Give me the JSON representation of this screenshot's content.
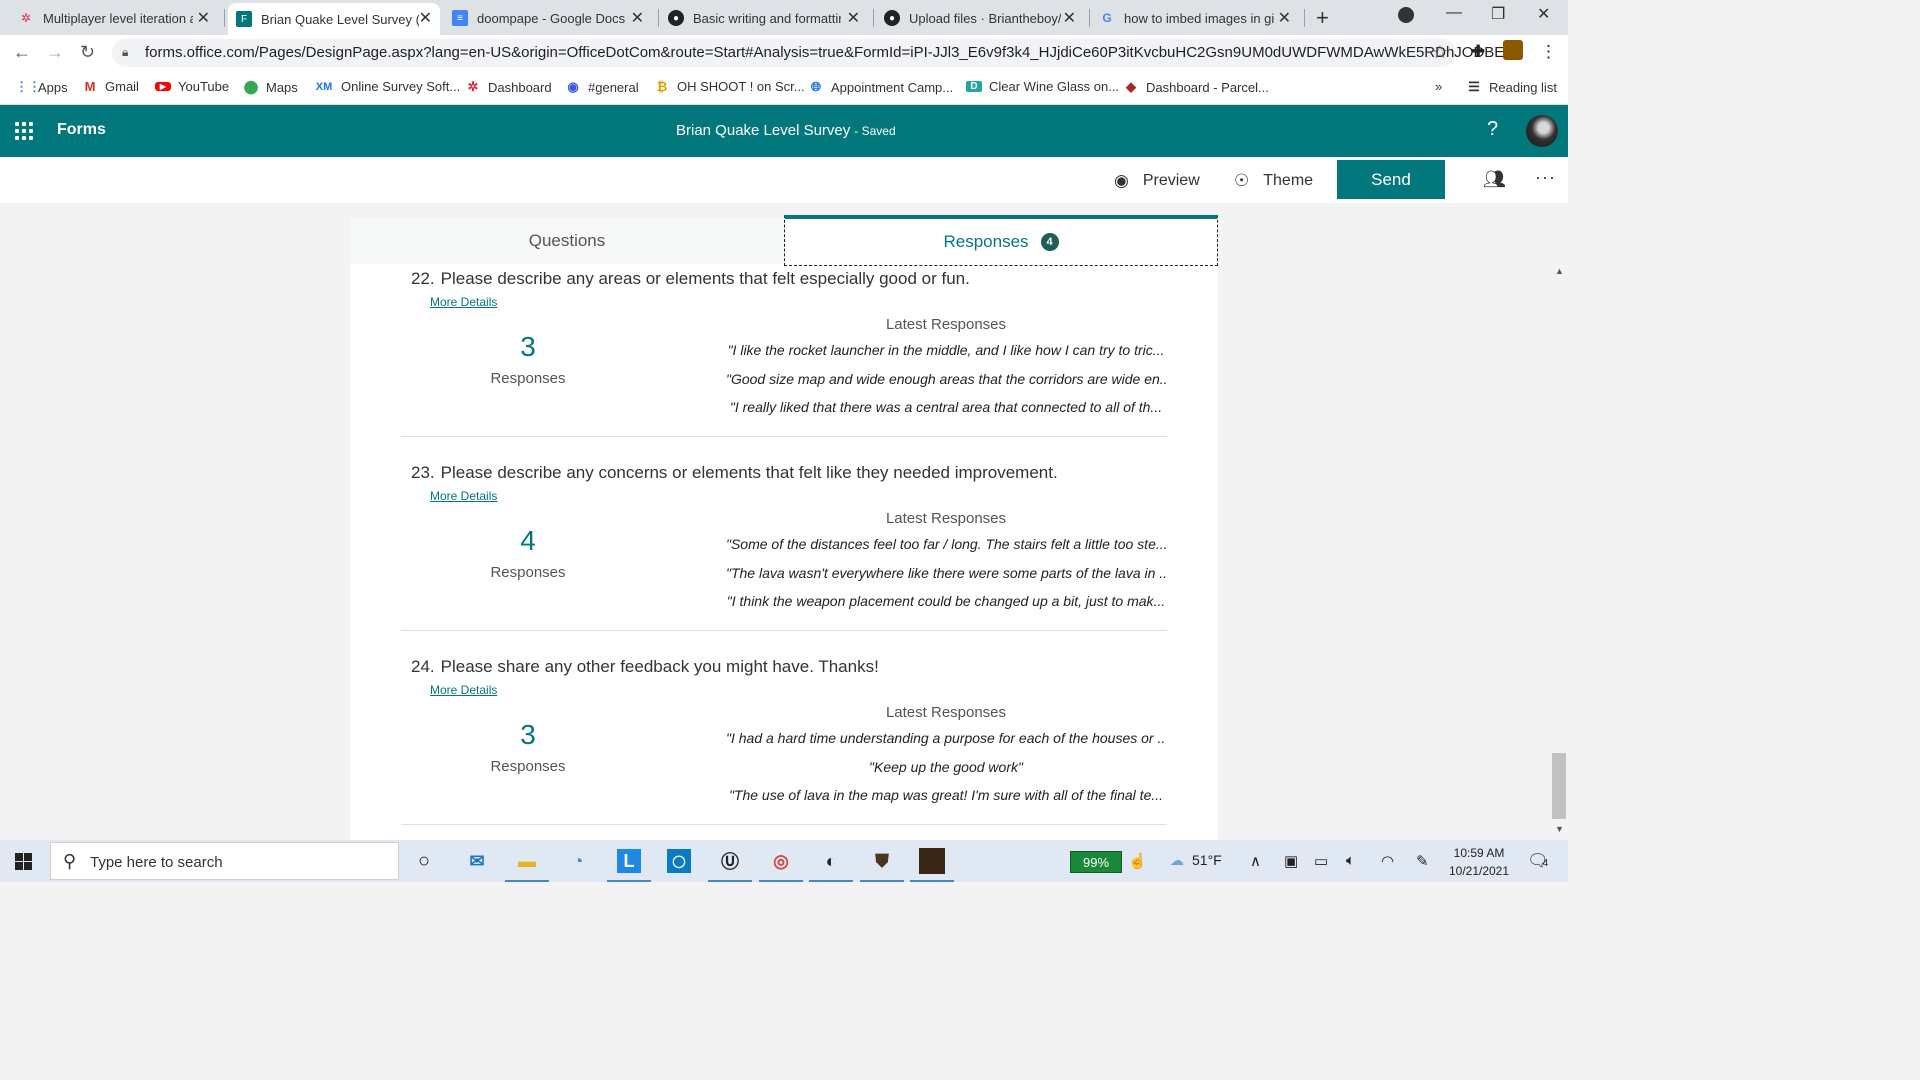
{
  "browser": {
    "tabs": [
      {
        "title": "Multiplayer level iteration a",
        "icon": "asterisk-icon"
      },
      {
        "title": "Brian Quake Level Survey (E",
        "icon": "forms-icon",
        "active": true
      },
      {
        "title": "doompape - Google Docs",
        "icon": "docs-icon"
      },
      {
        "title": "Basic writing and formattin",
        "icon": "github-icon"
      },
      {
        "title": "Upload files · Briantheboy/H",
        "icon": "github-icon"
      },
      {
        "title": "how to imbed images in git",
        "icon": "google-icon"
      }
    ],
    "url": "forms.office.com/Pages/DesignPage.aspx?lang=en-US&origin=OfficeDotCom&route=Start#Analysis=true&FormId=iPI-JJl3_E6v9f3k4_HJjdiCe60P3itKvcbuHC2Gsn9UM0dUWDFWMDAwWkE5RDhJODBE...",
    "bookmarks": [
      "Apps",
      "Gmail",
      "YouTube",
      "Maps",
      "Online Survey Soft...",
      "Dashboard",
      "#general",
      "OH SHOOT ! on Scr...",
      "Appointment Camp...",
      "Clear Wine Glass on...",
      "Dashboard - Parcel..."
    ],
    "bookmarks_more": "»",
    "reading_list": "Reading list"
  },
  "forms": {
    "app_name": "Forms",
    "form_title": "Brian Quake Level Survey",
    "status": "- Saved",
    "help": "?",
    "toolbar": {
      "preview": "Preview",
      "theme": "Theme",
      "send": "Send",
      "more": "···"
    },
    "tabs": {
      "questions": "Questions",
      "responses": "Responses",
      "responses_count": "4"
    }
  },
  "questions": [
    {
      "number": "22.",
      "title": "Please describe any areas or elements that felt especially good or fun.",
      "more_details": "More Details",
      "count": "3",
      "count_label": "Responses",
      "latest_header": "Latest Responses",
      "responses": [
        "\"I like the rocket launcher in the middle, and I like how I can try to tric...",
        "\"Good size map and wide enough areas that the corridors are wide en...",
        "\"I really liked that there was a central area that connected to all of th..."
      ]
    },
    {
      "number": "23.",
      "title": "Please describe any concerns or elements that felt like they needed improvement.",
      "more_details": "More Details",
      "count": "4",
      "count_label": "Responses",
      "latest_header": "Latest Responses",
      "responses": [
        "\"Some of the distances feel too far / long. The stairs felt a little too ste...",
        "\"The lava wasn't everywhere like there were some parts of the lava in ...",
        "\"I think the weapon placement could be changed up a bit, just to mak..."
      ]
    },
    {
      "number": "24.",
      "title": "Please share any other feedback you might have. Thanks!",
      "more_details": "More Details",
      "count": "3",
      "count_label": "Responses",
      "latest_header": "Latest Responses",
      "responses": [
        "\"I had a hard time understanding a purpose for each of the houses or ...",
        "\"Keep up the good work\"",
        "\"The use of lava in the map was great! I'm sure with all of the final te..."
      ]
    }
  ],
  "taskbar": {
    "search_placeholder": "Type here to search",
    "battery": "99%",
    "temperature": "51°F",
    "time": "10:59 AM",
    "date": "10/21/2021",
    "notifications": "4"
  },
  "colors": {
    "accent": "#03787c",
    "tab_bg": "#dee1e6",
    "badge": "#1f5e5c"
  }
}
